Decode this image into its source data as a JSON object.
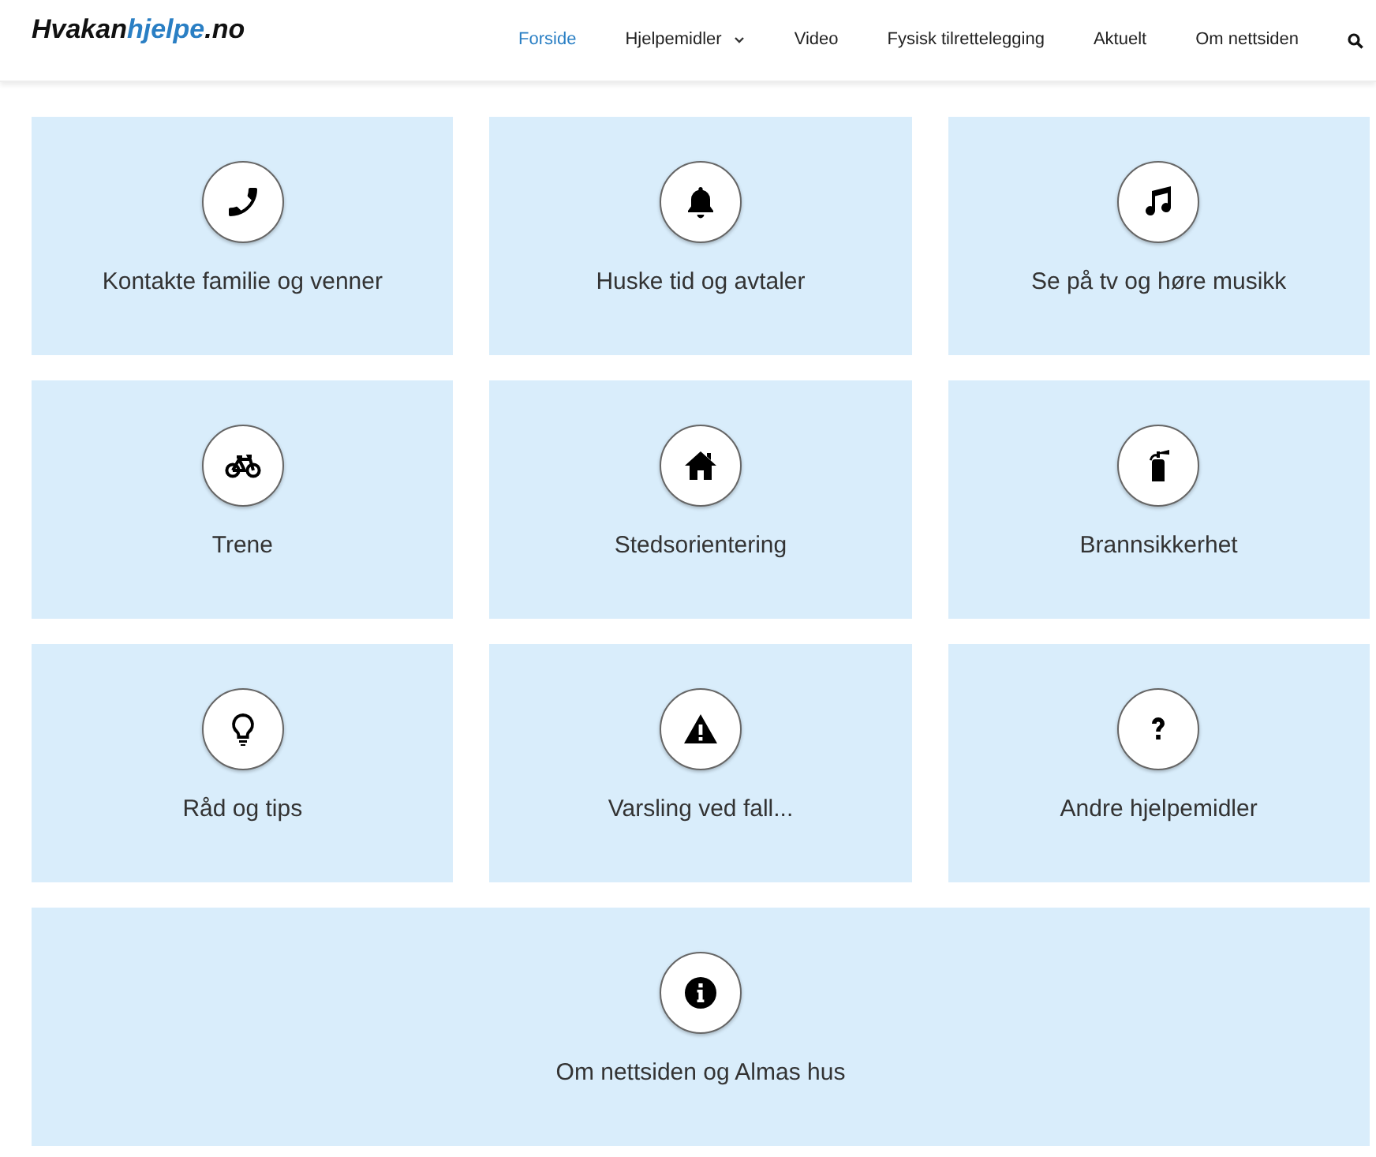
{
  "logo": [
    {
      "text": "Hvakan",
      "highlighted": false
    },
    {
      "text": "hjelpe",
      "highlighted": true
    },
    {
      "text": ".no",
      "highlighted": false
    }
  ],
  "nav": [
    {
      "label": "Forside",
      "selected": true,
      "has_menu": false
    },
    {
      "label": "Hjelpemidler",
      "selected": false,
      "has_menu": true
    },
    {
      "label": "Video",
      "selected": false,
      "has_menu": false
    },
    {
      "label": "Fysisk tilrettelegging",
      "selected": false,
      "has_menu": false
    },
    {
      "label": "Aktuelt",
      "selected": false,
      "has_menu": false
    },
    {
      "label": "Om nettsiden",
      "selected": false,
      "has_menu": false
    }
  ],
  "tiles": [
    {
      "label": "Kontakte familie og venner",
      "wide": false
    },
    {
      "label": "Huske tid og avtaler",
      "wide": false
    },
    {
      "label": "Se på tv og høre musikk",
      "wide": false
    },
    {
      "label": "Trene",
      "wide": false
    },
    {
      "label": "Stedsorientering",
      "wide": false
    },
    {
      "label": "Brannsikkerhet",
      "wide": false
    },
    {
      "label": "Råd og tips",
      "wide": false
    },
    {
      "label": "Varsling ved fall...",
      "wide": false
    },
    {
      "label": "Andre hjelpemidler",
      "wide": false
    },
    {
      "label": "Om nettsiden og Almas hus",
      "wide": true
    }
  ]
}
